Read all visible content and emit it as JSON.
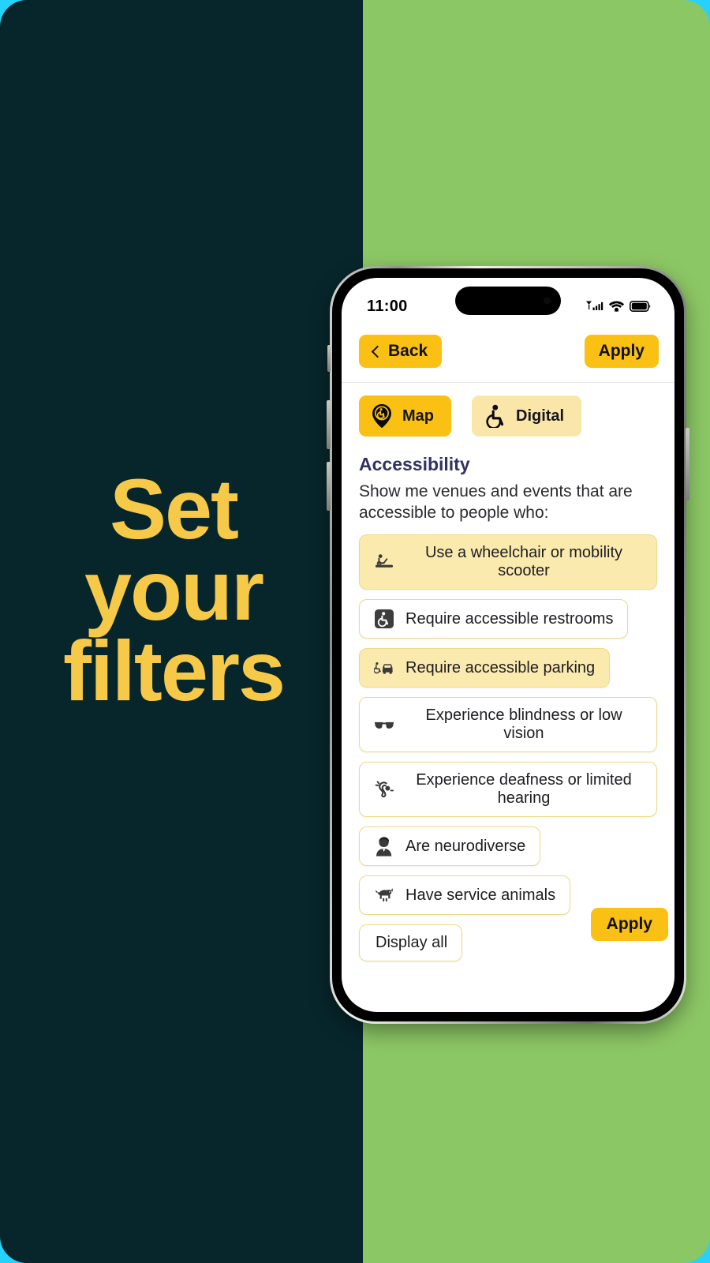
{
  "poster": {
    "headline_lines": [
      "Set",
      "your",
      "filters"
    ],
    "bg_outer_color": "#24d2fb",
    "bg_left_color": "#07262b",
    "bg_right_color": "#8cc765",
    "headline_color": "#f7c948"
  },
  "phone": {
    "status": {
      "time": "11:00",
      "cellular_icon": "cellular-signal-icon",
      "wifi_icon": "wifi-icon",
      "battery_icon": "battery-icon"
    },
    "nav": {
      "back_label": "Back",
      "back_icon": "chevron-left-icon",
      "apply_label": "Apply"
    },
    "tabs": [
      {
        "label": "Map",
        "icon": "map-pin-wheelchair-icon",
        "active": true
      },
      {
        "label": "Digital",
        "icon": "wheelchair-icon",
        "active": false
      }
    ],
    "section": {
      "title": "Accessibility",
      "subtitle": "Show me venues and events that are accessible to people who:"
    },
    "chips": [
      {
        "label": "Use a wheelchair or mobility scooter",
        "icon": "mobility-scooter-icon",
        "selected": true
      },
      {
        "label": "Require accessible restrooms",
        "icon": "accessible-restroom-icon",
        "selected": false
      },
      {
        "label": "Require accessible parking",
        "icon": "accessible-parking-icon",
        "selected": true
      },
      {
        "label": "Experience blindness or low vision",
        "icon": "sunglasses-icon",
        "selected": false
      },
      {
        "label": "Experience deafness or limited hearing",
        "icon": "ear-hearing-icon",
        "selected": false
      },
      {
        "label": "Are neurodiverse",
        "icon": "person-bust-icon",
        "selected": false
      },
      {
        "label": "Have service animals",
        "icon": "service-dog-icon",
        "selected": false
      },
      {
        "label": "Display all",
        "icon": "",
        "selected": false
      }
    ],
    "footer": {
      "apply_label": "Apply"
    },
    "colors": {
      "accent": "#fbc014",
      "accent_soft": "#fbeaad",
      "chip_border": "#edd98a",
      "heading": "#323164"
    }
  }
}
